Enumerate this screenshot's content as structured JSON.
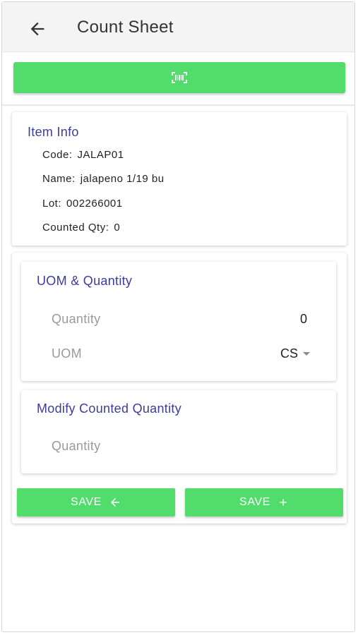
{
  "header": {
    "title": "Count Sheet",
    "back_icon": "arrow-left-icon"
  },
  "scan_button": {
    "icon": "barcode-scan-icon"
  },
  "item_info": {
    "heading": "Item Info",
    "rows": [
      {
        "label": "Code:",
        "value": "JALAP01"
      },
      {
        "label": "Name:",
        "value": "jalapeno 1/19 bu"
      },
      {
        "label": "Lot:",
        "value": "002266001"
      },
      {
        "label": "Counted Qty:",
        "value": "0"
      }
    ]
  },
  "uom_quantity": {
    "heading": "UOM & Quantity",
    "quantity_label": "Quantity",
    "quantity_value": "0",
    "uom_label": "UOM",
    "uom_value": "CS"
  },
  "modify_counted": {
    "heading": "Modify Counted Quantity",
    "quantity_placeholder": "Quantity"
  },
  "actions": {
    "save_back_label": "SAVE",
    "save_back_icon": "arrow-left-icon",
    "save_add_label": "SAVE",
    "save_add_icon": "plus-icon"
  },
  "colors": {
    "accent_green": "#52dc6c",
    "heading_blue": "#3b3ba0",
    "label_gray": "#9a9a9a"
  }
}
